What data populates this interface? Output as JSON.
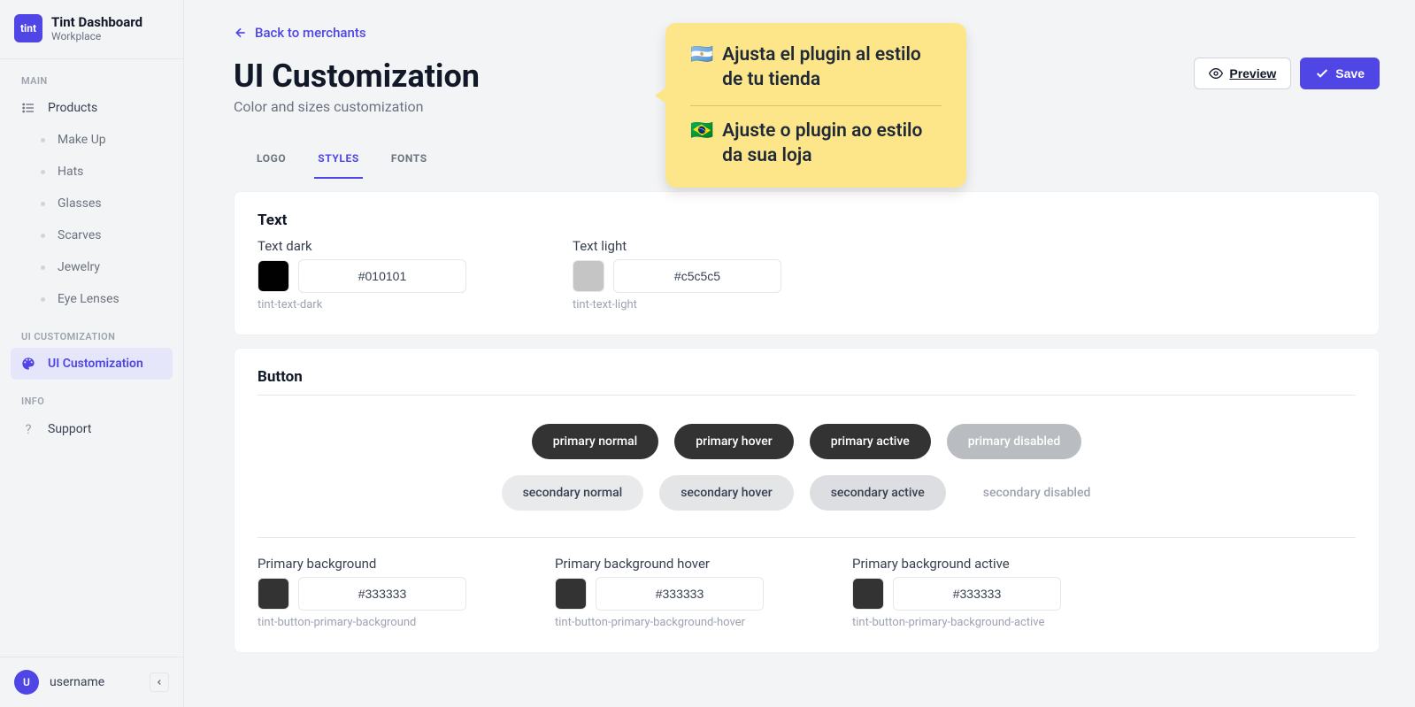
{
  "brand": {
    "logo": "tint",
    "title": "Tint Dashboard",
    "subtitle": "Workplace"
  },
  "sidebar": {
    "sections": {
      "main": "MAIN",
      "ui": "UI CUSTOMIZATION",
      "info": "INFO"
    },
    "products_label": "Products",
    "product_items": [
      "Make Up",
      "Hats",
      "Glasses",
      "Scarves",
      "Jewelry",
      "Eye Lenses"
    ],
    "ui_custom": "UI Customization",
    "support": "Support"
  },
  "user": {
    "initial": "U",
    "name": "username"
  },
  "page": {
    "back": "Back to merchants",
    "title": "UI Customization",
    "subtitle": "Color and sizes customization",
    "preview": "Preview",
    "save": "Save",
    "tabs": [
      "LOGO",
      "STYLES",
      "FONTS"
    ]
  },
  "callout": {
    "es": "Ajusta el plugin al estilo de tu tienda",
    "pt": "Ajuste o plugin ao estilo da sua loja"
  },
  "text_section": {
    "title": "Text",
    "dark": {
      "label": "Text dark",
      "value": "#010101",
      "hint": "tint-text-dark",
      "swatch": "#010101"
    },
    "light": {
      "label": "Text light",
      "value": "#c5c5c5",
      "hint": "tint-text-light",
      "swatch": "#c5c5c5"
    }
  },
  "button_section": {
    "title": "Button",
    "previews": {
      "primary_normal": "primary normal",
      "primary_hover": "primary hover",
      "primary_active": "primary active",
      "primary_disabled": "primary disabled",
      "secondary_normal": "secondary normal",
      "secondary_hover": "secondary hover",
      "secondary_active": "secondary active",
      "secondary_disabled": "secondary disabled"
    },
    "fields": {
      "bg": {
        "label": "Primary background",
        "value": "#333333",
        "hint": "tint-button-primary-background",
        "swatch": "#333333"
      },
      "bg_hover": {
        "label": "Primary background hover",
        "value": "#333333",
        "hint": "tint-button-primary-background-hover",
        "swatch": "#333333"
      },
      "bg_active": {
        "label": "Primary background active",
        "value": "#333333",
        "hint": "tint-button-primary-background-active",
        "swatch": "#333333"
      }
    }
  }
}
